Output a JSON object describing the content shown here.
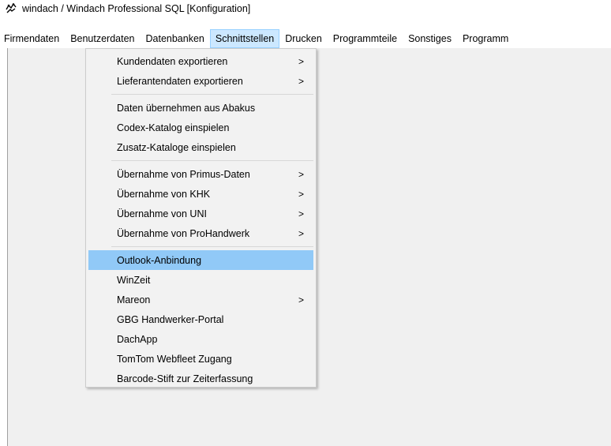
{
  "window": {
    "title": "windach / Windach Professional SQL [Konfiguration]",
    "icon": "app-logo-icon"
  },
  "menubar": {
    "items": [
      {
        "label": "Firmendaten"
      },
      {
        "label": "Benutzerdaten"
      },
      {
        "label": "Datenbanken"
      },
      {
        "label": "Schnittstellen",
        "open": true
      },
      {
        "label": "Drucken"
      },
      {
        "label": "Programmteile"
      },
      {
        "label": "Sonstiges"
      },
      {
        "label": "Programm"
      }
    ]
  },
  "dropdown": {
    "groups": [
      [
        {
          "label": "Kundendaten exportieren",
          "submenu": true
        },
        {
          "label": "Lieferantendaten exportieren",
          "submenu": true
        }
      ],
      [
        {
          "label": "Daten übernehmen aus Abakus",
          "submenu": false
        },
        {
          "label": "Codex-Katalog einspielen",
          "submenu": false
        },
        {
          "label": "Zusatz-Kataloge einspielen",
          "submenu": false
        }
      ],
      [
        {
          "label": "Übernahme von Primus-Daten",
          "submenu": true
        },
        {
          "label": "Übernahme von KHK",
          "submenu": true
        },
        {
          "label": "Übernahme von UNI",
          "submenu": true
        },
        {
          "label": "Übernahme von ProHandwerk",
          "submenu": true
        }
      ],
      [
        {
          "label": "Outlook-Anbindung",
          "submenu": false,
          "highlighted": true
        },
        {
          "label": "WinZeit",
          "submenu": false
        },
        {
          "label": "Mareon",
          "submenu": true
        },
        {
          "label": "GBG Handwerker-Portal",
          "submenu": false
        },
        {
          "label": "DachApp",
          "submenu": false
        },
        {
          "label": "TomTom Webfleet Zugang",
          "submenu": false
        },
        {
          "label": "Barcode-Stift zur Zeiterfassung",
          "submenu": false
        }
      ]
    ],
    "arrow_glyph": ">"
  },
  "colors": {
    "menu_open_bg": "#cce8ff",
    "menu_highlight_bg": "#91c9f7",
    "workarea_bg": "#f0f0f0"
  }
}
